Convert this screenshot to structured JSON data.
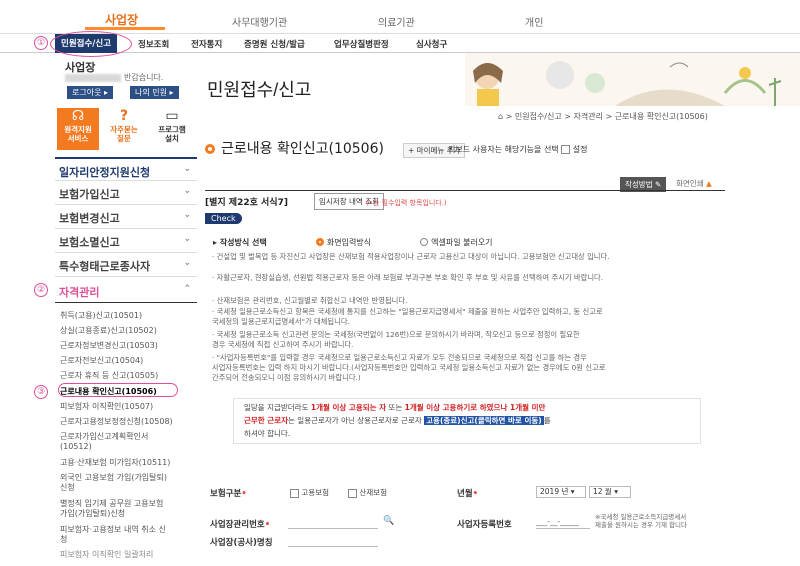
{
  "top_tabs": [
    {
      "label": "사업장",
      "active": true
    },
    {
      "label": "사무대행기관",
      "active": false
    },
    {
      "label": "의료기관",
      "active": false
    },
    {
      "label": "개인",
      "active": false
    }
  ],
  "annotations": {
    "n1": "①",
    "n2": "②",
    "n3": "③"
  },
  "menu": [
    {
      "label": "민원접수/신고",
      "active": true
    },
    {
      "label": "정보조회"
    },
    {
      "label": "전자통지"
    },
    {
      "label": "증명원 신청/발급"
    },
    {
      "label": "업무상질병판정"
    },
    {
      "label": "심사청구"
    }
  ],
  "sidebar": {
    "title": "사업장",
    "greeting_suffix": "반갑습니다.",
    "logout": "로그아웃",
    "my_civil": "나의 민원",
    "services": [
      {
        "line1": "원격지원",
        "line2": "서비스",
        "icon": "headset-icon"
      },
      {
        "line1": "자주묻는",
        "line2": "질문",
        "icon": "question-icon"
      },
      {
        "line1": "프로그램",
        "line2": "설치",
        "icon": "monitor-icon"
      }
    ],
    "sections": [
      {
        "label": "일자리안정지원신청"
      },
      {
        "label": "보험가입신고"
      },
      {
        "label": "보험변경신고"
      },
      {
        "label": "보험소멸신고"
      },
      {
        "label": "특수형태근로종사자"
      },
      {
        "label": "자격관리"
      }
    ],
    "sub_items": [
      "취득(고용)신고(10501)",
      "상실(고용종료)신고(10502)",
      "근로자정보변경신고(10503)",
      "근로자전보신고(10504)",
      "근로자 휴직 등 신고(10505)",
      "근로내용 확인신고(10506)",
      "피보험자 이직확인(10507)",
      "근로자고용정보정정신청(10508)",
      "근로자가입신고계획확인서",
      "(10512)",
      "고용·산재보험 미가입자(10511)",
      "외국인 고용보험 가입(가입탈퇴)",
      "신청",
      "별정직 임기제 공무원 고용보험",
      "가입(가입탈퇴)신청",
      "피보험자·고용정보 내역 취소 신",
      "청",
      "피보험자 이직확인 일괄처리"
    ]
  },
  "main": {
    "page_title": "민원접수/신고",
    "breadcrumb": "⌂ > 민원접수/신고 > 자격관리 > 근로내용 확인신고(10506)",
    "section_title": "근로내용 확인신고(10506)",
    "fav_button": "+ 마이메뉴 추가",
    "keyboard_text": "키보드 사용자는 해당기능을 선택",
    "keyboard_cb_label": "설정",
    "guide_button": "작성방법",
    "print_text": "화면인쇄",
    "form_no": "[별지 제22호 서식7]",
    "temp_button": "임시저장 내역 조회",
    "required_note": "(•는 필수입력 항목입니다.)",
    "check_tag": "Check",
    "method_label": "작성방식 선택",
    "method_opt1": "화면입력방식",
    "method_opt2": "엑셀파일 불러오기",
    "notes": [
      "· 건설업 및 벌목업 등 자진신고 사업장은 산재보험 적용사업장이나 근로자 고용신고 대상이 아닙니다. 고용보험만 신고대상 입니다.",
      "· 자활근로자, 현장실습생, 선원법 적용근로자 등은 아래 보험료 부과구분 부호 확인 후 부호 및 사유를 선택하여 주시기 바랍니다.",
      "· 산재보험은 관리번호, 신고월별로 취합신고 내역만 반영됩니다.",
      "· 국세청 일용근로소득신고 항목은 국세청에 통지를 신고하는 \"일용근로지급명세서\" 제출을 원하는 사업주만 입력하고, 동 신고로",
      "  국세청의 일용근로지급명세서\"가 대체됩니다.",
      "· 국세청 일용근로소득 신고관련 문의는 국세청(국번없이 126번)으로 문의하시기 바라며, 작오신고 등으로 정정이 필요한",
      "  경우 국세청에 직접 신고하여 주시기 바랍니다.",
      "· \"사업자등록번호\"를 입력할 경우 국세청으로 일용근로소득신고 자료가 모두 전송되므로 국세청으로 직접 신고를 하는 경우",
      "  사업자등록번호는 입력 하지 마시기 바랍니다.(사업자등록번호만 입력하고 국세청 일용소득신고 자료가 없는 경우에도 0원 신고로",
      "  간주되어 전송되오니 이점 유의하시기 바랍니다.)"
    ],
    "info_line1_a": "일당을 지급받더라도 ",
    "info_line1_red1": "1개월 이상 고용되는 자",
    "info_line1_b": " 또는 ",
    "info_line1_red2": "1개월 이상 고용하기로 하였으나 1개월 미만",
    "info_line2_red": "근무한 근로자",
    "info_line2_b": "는 일용근로자가 아닌 상용근로자로 근로자 ",
    "info_line2_link": "고용(종료)신고(클릭하면 바로 이동)",
    "info_line2_c": "를",
    "info_line3": "하셔야 합니다.",
    "fields": {
      "insurance_label": "보험구분",
      "cb_employment": "고용보험",
      "cb_industrial": "산재보험",
      "yearmonth_label": "년월",
      "year_value": "2019 년",
      "month_value": "12 월",
      "mgmt_label": "사업장관리번호",
      "bizno_label": "사업자등록번호",
      "bizno_placeholder": "___-__-_____",
      "bizno_note1": "※국세청 일용근로소득지급명세서",
      "bizno_note2": "제출을 원하시는 경우 기재 합니다",
      "site_label": "사업장(공사)명칭"
    }
  }
}
